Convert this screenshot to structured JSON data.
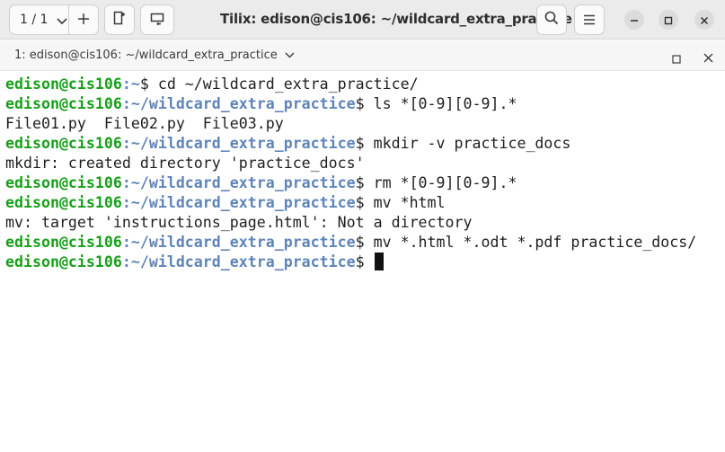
{
  "headerbar": {
    "session_label": "1 / 1",
    "title": "Tilix: edison@cis106: ~/wildcard_extra_practice"
  },
  "terminal_tab": {
    "label": "1: edison@cis106: ~/wildcard_extra_practice"
  },
  "terminal": {
    "lines": [
      {
        "user": "edison@cis106",
        "path": ":~",
        "cmd": "$ cd ~/wildcard_extra_practice/"
      },
      {
        "user": "edison@cis106",
        "path": ":~/wildcard_extra_practice",
        "cmd": "$ ls *[0-9][0-9].*"
      },
      {
        "text": "File01.py  File02.py  File03.py"
      },
      {
        "user": "edison@cis106",
        "path": ":~/wildcard_extra_practice",
        "cmd": "$ mkdir -v practice_docs"
      },
      {
        "text": "mkdir: created directory 'practice_docs'"
      },
      {
        "user": "edison@cis106",
        "path": ":~/wildcard_extra_practice",
        "cmd": "$ rm *[0-9][0-9].*"
      },
      {
        "user": "edison@cis106",
        "path": ":~/wildcard_extra_practice",
        "cmd": "$ mv *html"
      },
      {
        "text": "mv: target 'instructions_page.html': Not a directory"
      },
      {
        "user": "edison@cis106",
        "path": ":~/wildcard_extra_practice",
        "cmd": "$ mv *.html *.odt *.pdf practice_docs/"
      },
      {
        "user": "edison@cis106",
        "path": ":~/wildcard_extra_practice",
        "cmd": "$ ",
        "cursor": true
      }
    ]
  },
  "colors": {
    "user": "#17a01a",
    "path": "#5f84b8",
    "text": "#1e1e1e"
  }
}
